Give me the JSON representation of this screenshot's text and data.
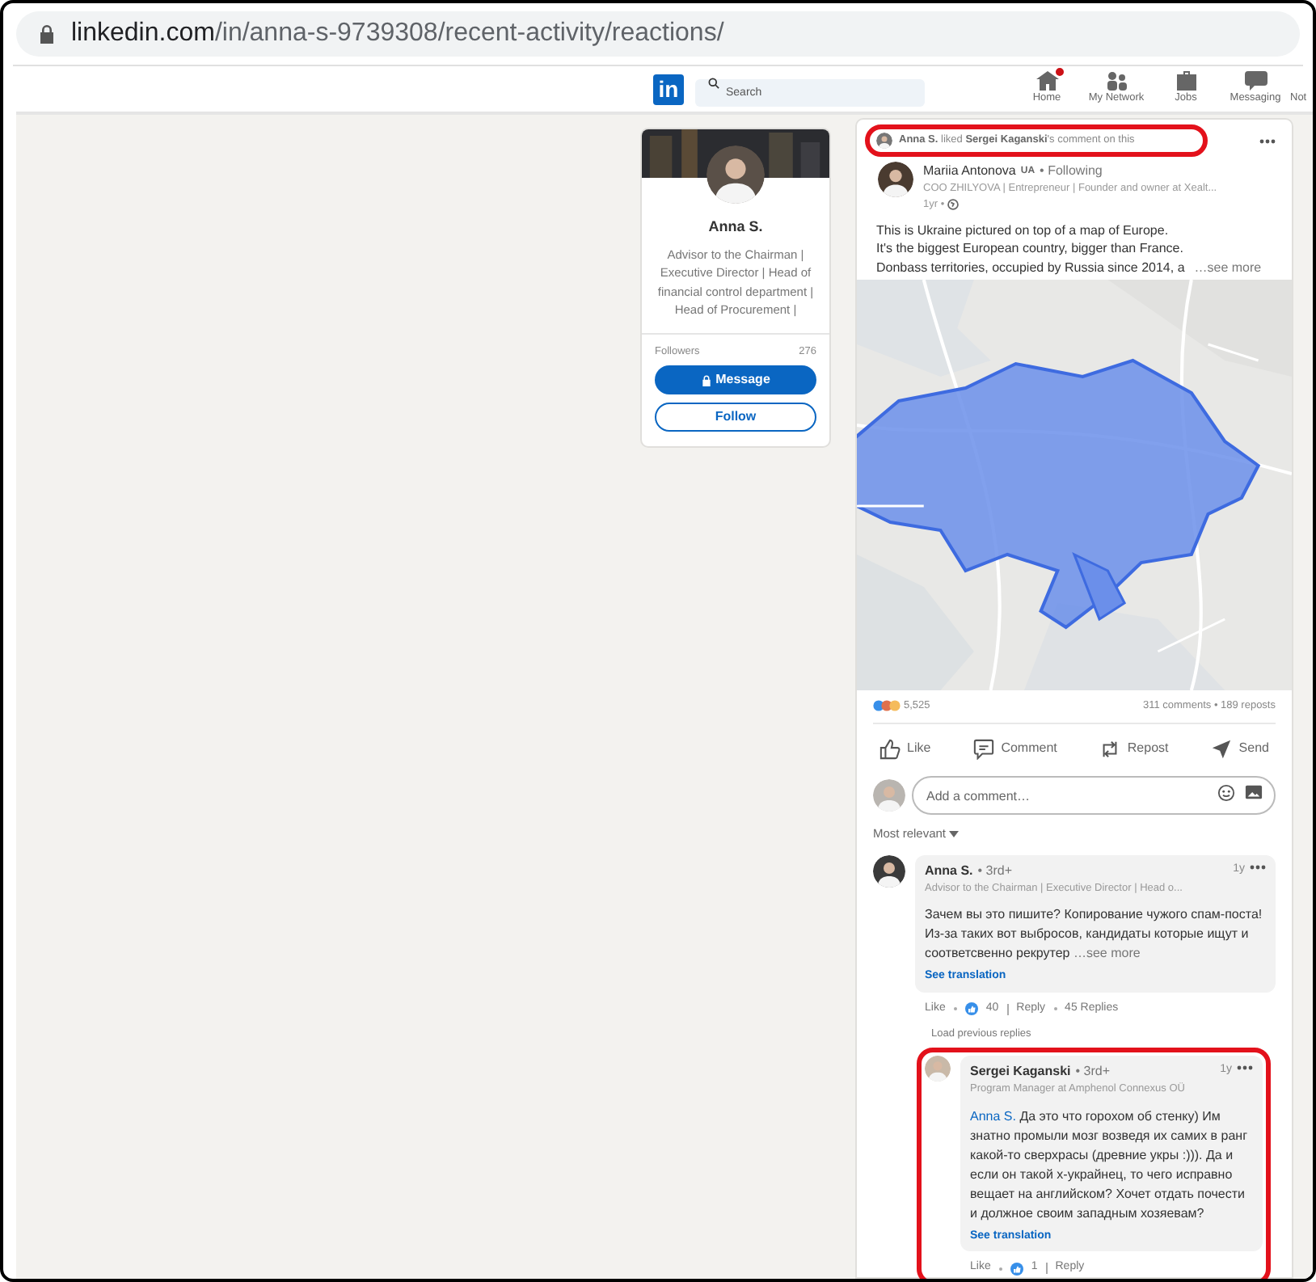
{
  "browser": {
    "url_host": "linkedin.com",
    "url_path": "/in/anna-s-9739308/recent-activity/reactions/"
  },
  "nav": {
    "logo": "in",
    "search_placeholder": "Search",
    "items": [
      {
        "label": "Home",
        "kind": "home",
        "notification": true
      },
      {
        "label": "My Network",
        "kind": "network",
        "notification": false
      },
      {
        "label": "Jobs",
        "kind": "jobs",
        "notification": false
      },
      {
        "label": "Messaging",
        "kind": "messaging",
        "notification": false
      },
      {
        "label": "Not",
        "kind": "cut",
        "notification": false
      }
    ]
  },
  "profile": {
    "name": "Anna S.",
    "headline": "Advisor to the Chairman | Executive Director | Head of financial control department | Head of Procurement |",
    "followers_label": "Followers",
    "followers_count": "276",
    "message_button": "Message",
    "follow_button": "Follow"
  },
  "activity": {
    "actor": "Anna S.",
    "verb": "liked",
    "target": "Sergei Kaganski",
    "rest": "'s comment on this",
    "highlighted": true
  },
  "post": {
    "author": "Mariia Antonova",
    "flag": "UA",
    "following": "• Following",
    "headline": "COO ZHILYOVA | Entrepreneur | Founder and owner at Xealt...",
    "time": "1yr •",
    "lines": [
      "This is Ukraine pictured on top of a map of Europe.",
      "It's the biggest European country, bigger than France.",
      "Donbass territories, occupied by Russia since 2014, a"
    ],
    "see_more": "…see more",
    "map": {
      "kind": "picture"
    },
    "reactions_count": "5,525",
    "stats": "311 comments • 189 reposts",
    "actions": [
      {
        "label": "Like",
        "kind": "like"
      },
      {
        "label": "Comment",
        "kind": "comment"
      },
      {
        "label": "Repost",
        "kind": "repost"
      },
      {
        "label": "Send",
        "kind": "send"
      }
    ],
    "comment_placeholder": "Add a comment…",
    "sort": "Most relevant"
  },
  "comments": [
    {
      "author": "Anna S.",
      "degree": "• 3rd+",
      "headline": "Advisor to the Chairman | Executive Director | Head o...",
      "time": "1y",
      "text": "Зачем вы это пишите? Копирование чужого спам-поста! Из-за таких вот выбросов, кандидаты которые ищут и соответсвенно рекрутер",
      "see_more": "…see more",
      "translation": "See translation",
      "like": "Like",
      "reaction_count": "40",
      "reply": "Reply",
      "replies": "45 Replies",
      "highlighted": false
    }
  ],
  "load_previous": "Load previous replies",
  "replies": [
    {
      "author": "Sergei Kaganski",
      "degree": "• 3rd+",
      "headline": "Program Manager at Amphenol Connexus OÜ",
      "time": "1y",
      "mention": "Anna S.",
      "text": "Да это что горохом об стенку) Им знатно промыли мозг возведя их самих в ранг какой-то сверхрасы (древние укры :))). Да и если он такой х-украйнец, то чего исправно вещает на английском? Хочет отдать почести и должное своим западным хозяевам?",
      "translation": "See translation",
      "like": "Like",
      "reaction_count": "1",
      "reply": "Reply",
      "highlighted": true
    }
  ]
}
